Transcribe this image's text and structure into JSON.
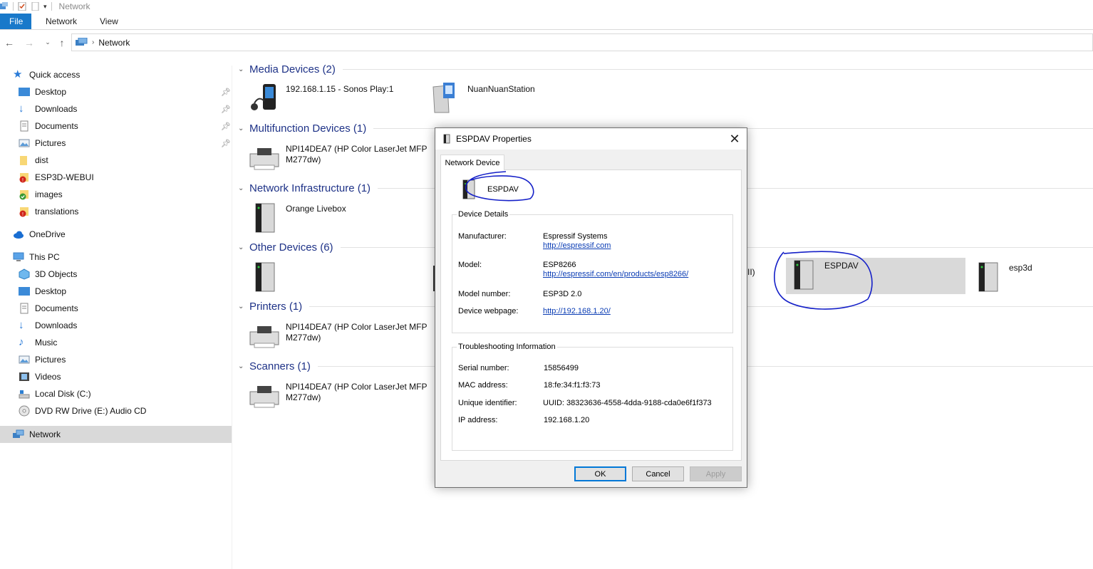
{
  "window": {
    "title": "Network"
  },
  "ribbon": {
    "tabs": [
      "File",
      "Network",
      "View"
    ]
  },
  "address": {
    "crumb": "Network"
  },
  "sidebar": {
    "quick_access": "Quick access",
    "quick_items": [
      "Desktop",
      "Downloads",
      "Documents",
      "Pictures",
      "dist",
      "ESP3D-WEBUI",
      "images",
      "translations"
    ],
    "onedrive": "OneDrive",
    "this_pc": "This PC",
    "pc_items": [
      "3D Objects",
      "Desktop",
      "Documents",
      "Downloads",
      "Music",
      "Pictures",
      "Videos",
      "Local Disk (C:)",
      "DVD RW Drive (E:) Audio CD"
    ],
    "network": "Network"
  },
  "groups": {
    "media": "Media Devices (2)",
    "multifunction": "Multifunction Devices (1)",
    "infrastructure": "Network Infrastructure (1)",
    "other": "Other Devices (6)",
    "printers": "Printers (1)",
    "scanners": "Scanners (1)"
  },
  "devices": {
    "sonos": "192.168.1.15 - Sonos Play:1",
    "nuannuan": "NuanNuanStation",
    "hp_line1": "NPI14DEA7 (HP Color LaserJet MFP",
    "hp_line2": "M277dw)",
    "livebox": "Orange Livebox",
    "partial": "II)",
    "espdav": "ESPDAV",
    "esp3d": "esp3d"
  },
  "dialog": {
    "title": "ESPDAV Properties",
    "tab": "Network Device",
    "device_name": "ESPDAV",
    "details_legend": "Device Details",
    "manufacturer_label": "Manufacturer:",
    "manufacturer_value": "Espressif Systems",
    "manufacturer_link": "http://espressif.com",
    "model_label": "Model:",
    "model_value": "ESP8266",
    "model_link": "http://espressif.com/en/products/esp8266/",
    "model_number_label": "Model number:",
    "model_number_value": "ESP3D 2.0",
    "webpage_label": "Device webpage:",
    "webpage_link": "http://192.168.1.20/",
    "trouble_legend": "Troubleshooting Information",
    "serial_label": "Serial number:",
    "serial_value": "15856499",
    "mac_label": "MAC address:",
    "mac_value": "18:fe:34:f1:f3:73",
    "uid_label": "Unique identifier:",
    "uid_value": "UUID: 38323636-4558-4dda-9188-cda0e6f1f373",
    "ip_label": "IP address:",
    "ip_value": "192.168.1.20",
    "ok": "OK",
    "cancel": "Cancel",
    "apply": "Apply"
  },
  "colors": {
    "accent": "#1979ca",
    "group_title": "#1e3287",
    "link": "#0a3cb4",
    "annotation": "#1520c8"
  }
}
